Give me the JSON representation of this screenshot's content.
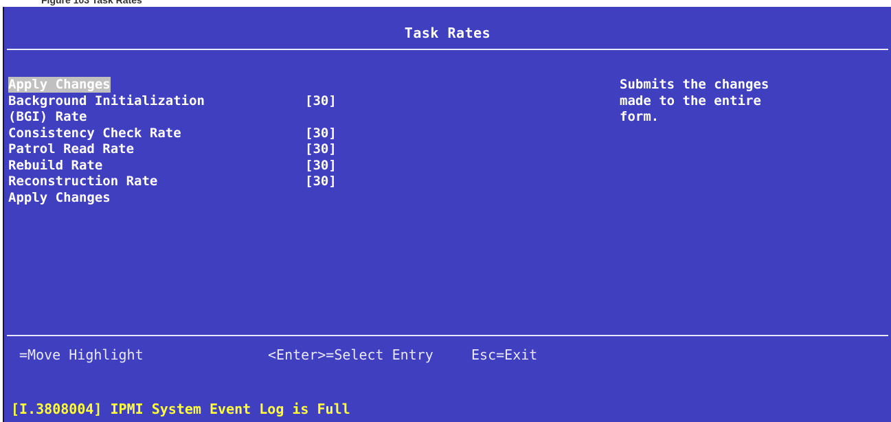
{
  "caption": "Figure 103 Task Rates",
  "screen": {
    "title": "Task Rates",
    "menu": [
      {
        "label": "Apply Changes",
        "value": "",
        "selected": true
      },
      {
        "label": "Background Initialization",
        "value": "[30]",
        "selected": false
      },
      {
        "label": "(BGI) Rate",
        "value": "",
        "selected": false
      },
      {
        "label": "Consistency Check Rate",
        "value": "[30]",
        "selected": false
      },
      {
        "label": "Patrol Read Rate",
        "value": "[30]",
        "selected": false
      },
      {
        "label": "Rebuild Rate",
        "value": "[30]",
        "selected": false
      },
      {
        "label": "Reconstruction Rate",
        "value": "[30]",
        "selected": false
      },
      {
        "label": "Apply Changes",
        "value": "",
        "selected": false
      }
    ],
    "help_text": "Submits the changes\nmade to the entire\nform.",
    "footer": {
      "move": "=Move Highlight",
      "select": "<Enter>=Select Entry",
      "exit": "Esc=Exit"
    },
    "status_line": "[I.3808004] IPMI System Event Log is Full"
  },
  "colors": {
    "background": "#3f3fbf",
    "text": "#ffffff",
    "highlight": "#c0c0c0",
    "status": "#ffff3c"
  }
}
